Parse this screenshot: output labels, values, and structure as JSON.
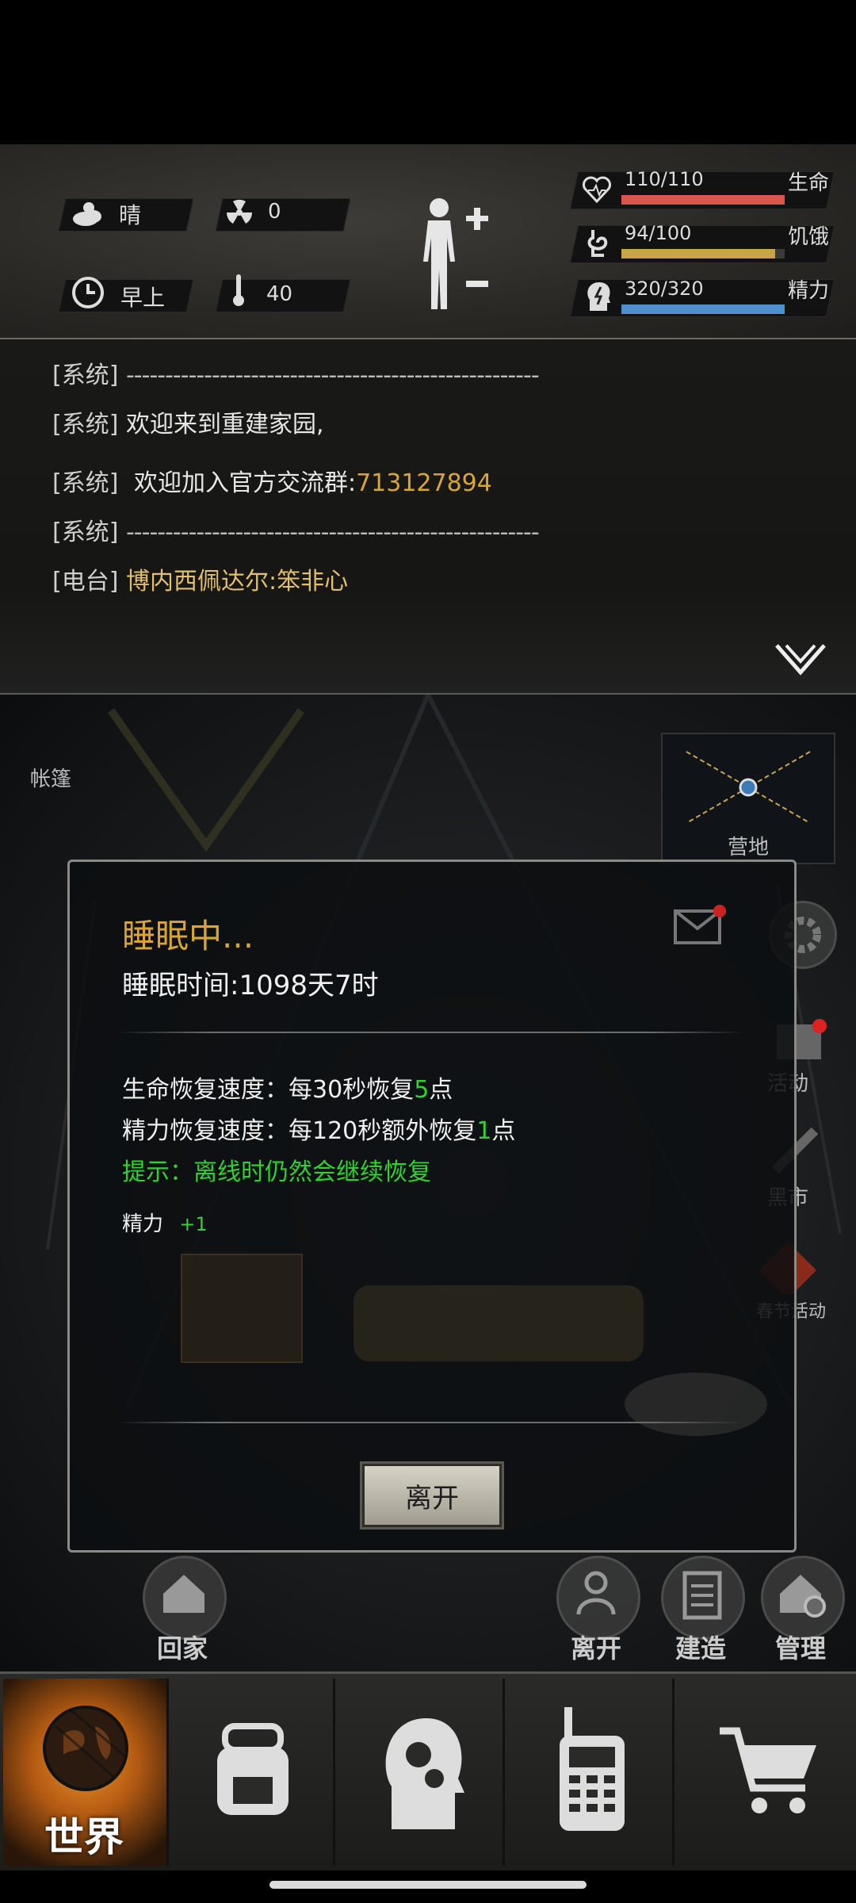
{
  "status": {
    "weather": "晴",
    "radiation": "0",
    "time_of_day": "早上",
    "temperature": "40",
    "bars": [
      {
        "value_text": "110/110",
        "label": "生命",
        "fraction": 1.0,
        "color": "#d8564c"
      },
      {
        "value_text": "94/100",
        "label": "饥饿",
        "fraction": 0.94,
        "color": "#c9a54a"
      },
      {
        "value_text": "320/320",
        "label": "精力",
        "fraction": 1.0,
        "color": "#4f8fd0"
      }
    ]
  },
  "log": {
    "tag_system": "[系统]",
    "tag_radio": "[电台]",
    "line1": "-----------------------------------------------------",
    "line2": "欢迎来到重建家园,",
    "line3_prefix": "欢迎加入官方交流群:",
    "line3_number": "713127894",
    "line4": "-----------------------------------------------------",
    "line5_sender": "博内西佩达尔",
    "line5_text": ":笨非心"
  },
  "scene": {
    "location_label": "帐篷",
    "camp_label": "营地",
    "side_menu": [
      "活动",
      "黑市",
      "春节活动"
    ],
    "quick_actions": {
      "home": "回家",
      "leave": "离开",
      "build": "建造",
      "manage": "管理"
    }
  },
  "dialog": {
    "title": "睡眠中...",
    "duration": "睡眠时间:1098天7时",
    "hp_prefix": "生命恢复速度：每30秒恢复",
    "hp_num": "5",
    "hp_suffix": "点",
    "en_prefix": "精力恢复速度：每120秒额外恢复",
    "en_num": "1",
    "en_suffix": "点",
    "hint": "提示：离线时仍然会继续恢复",
    "gain_label": "精力",
    "gain_value": "+1",
    "leave_button": "离开"
  },
  "nav": {
    "world": "世界"
  },
  "colors": {
    "gold": "#d9a634",
    "green": "#2fd22f",
    "yellow_text": "#e2bf6a"
  }
}
